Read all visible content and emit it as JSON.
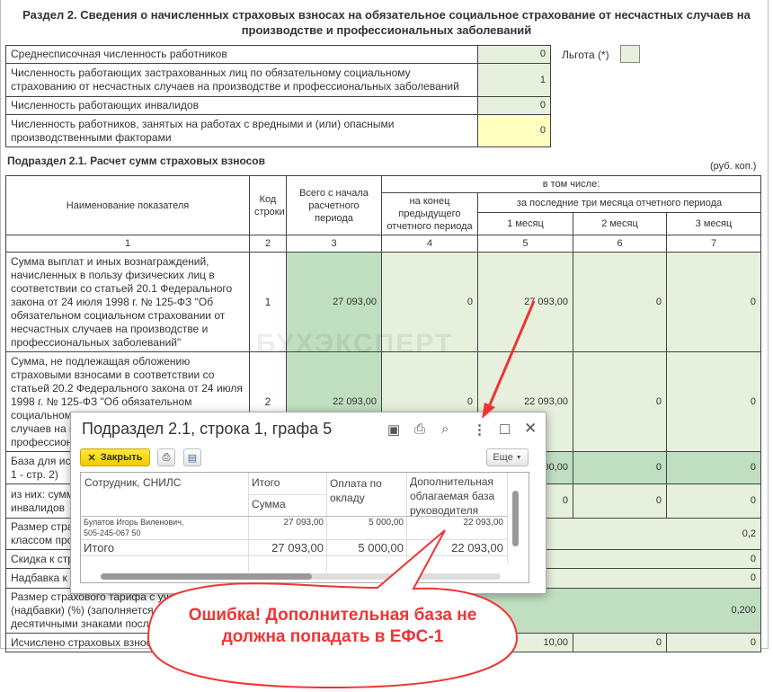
{
  "section_title": "Раздел 2. Сведения о начисленных страховых взносах на обязательное социальное страхование от несчастных случаев на производстве и профессиональных заболеваний",
  "top_rows": [
    {
      "label": "Среднесписочная численность работников",
      "value": "0"
    },
    {
      "label": "Численность работающих застрахованных лиц по обязательному социальному страхованию от несчастных случаев на производстве и профессиональных заболеваний",
      "value": "1"
    },
    {
      "label": "Численность работающих инвалидов",
      "value": "0"
    },
    {
      "label": "Численность работников, занятых на работах с вредными и (или) опасными производственными факторами",
      "value": "0"
    }
  ],
  "benefit_label": "Льгота (*)",
  "subsection_title": "Подраздел 2.1. Расчет сумм страховых взносов",
  "units": "(руб. коп.)",
  "headers": {
    "name": "Наименование показателя",
    "code": "Код строки",
    "total": "Всего с начала расчетного периода",
    "incl": "в том числе:",
    "prev": "на конец предыдущего отчетного периода",
    "last3": "за последние три месяца отчетного периода",
    "m1": "1 месяц",
    "m2": "2 месяц",
    "m3": "3 месяц",
    "nums": [
      "1",
      "2",
      "3",
      "4",
      "5",
      "6",
      "7"
    ]
  },
  "rows": [
    {
      "label": "Сумма выплат и иных вознаграждений, начисленных в пользу физических лиц в соответствии со статьей 20.1 Федерального закона от 24 июля 1998 г. № 125-ФЗ \"Об обязательном социальном страховании от несчастных случаев на производстве и профессиональных заболеваний\"",
      "code": "1",
      "c3": "27 093,00",
      "c4": "0",
      "c5": "27 093,00",
      "c6": "0",
      "c7": "0"
    },
    {
      "label": "Сумма, не подлежащая обложению страховыми взносами в соответствии со статьей 20.2 Федерального закона от 24 июля 1998 г. № 125-ФЗ \"Об обязательном социальном страховании от несчастных случаев на производстве и профессиональных заболеваний\"",
      "code": "2",
      "c3": "22 093,00",
      "c4": "0",
      "c5": "22 093,00",
      "c6": "0",
      "c7": "0"
    },
    {
      "label": "База для исчисления страховых взносов (стр. 1 - стр. 2)",
      "c5": "5 000,00",
      "c6": "0",
      "c7": "0"
    },
    {
      "label": "из них: сумма выплат в пользу работающих инвалидов",
      "c5": "0",
      "c6": "0",
      "c7": "0"
    },
    {
      "label": "Размер страхового тарифа в соответствии с классом профессионального риска (%)",
      "value": "0,2"
    },
    {
      "label": "Скидка к страховому тарифу (%)",
      "value": "0"
    },
    {
      "label": "Надбавка к страховому тарифу (%)",
      "value": "0"
    },
    {
      "label": "Размер страхового тарифа с учетом скидки (надбавки) (%) (заполняется с тремя десятичными знаками после запятой)",
      "value": "0,200"
    },
    {
      "label": "Исчислено страховых взносов",
      "c5": "10,00",
      "c6": "0",
      "c7": "0"
    }
  ],
  "watermark": "БУХЭКСПЕРТ",
  "popup": {
    "title": "Подраздел 2.1, строка 1, графа 5",
    "close": "Закрыть",
    "more": "Еще",
    "cols": {
      "employee": "Сотрудник, СНИЛС",
      "total": "Итого",
      "sum": "Сумма",
      "salary": "Оплата по окладу",
      "extra": "Дополнительная облагаемая база руководителя"
    },
    "row": {
      "name": "Булатов Игорь Виленович,",
      "snils": "505-245-067 50",
      "total": "27 093,00",
      "salary": "5 000,00",
      "extra": "22 093,00"
    },
    "footer": {
      "label": "Итого",
      "total": "27 093,00",
      "salary": "5 000,00",
      "extra": "22 093,00"
    }
  },
  "callout": "Ошибка! Дополнительная база не должна попадать в ЕФС-1",
  "colors": {
    "callout": "#f03434",
    "green": "#c0dfc1",
    "light_green": "#e6f0dc"
  }
}
